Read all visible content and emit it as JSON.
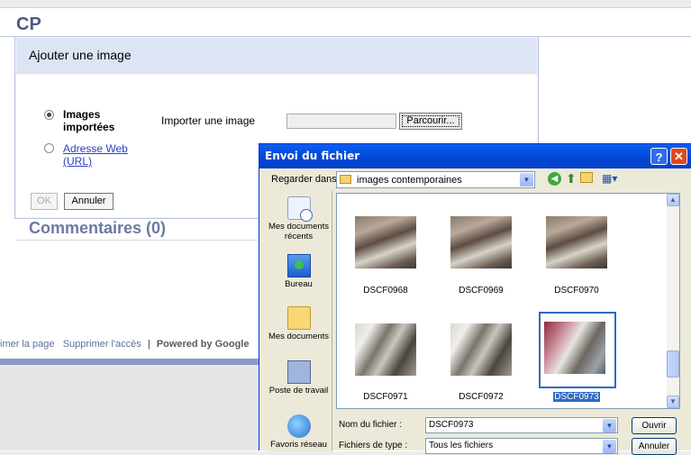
{
  "page": {
    "title": "CP",
    "comments_heading": "Commentaires (0)",
    "footer": {
      "link1": "imer la page",
      "link2": "Supprimer l'accès",
      "separator": "|",
      "powered": "Powered by Google"
    }
  },
  "add_image_dialog": {
    "title": "Ajouter une image",
    "options": {
      "imported": "Images importées",
      "web": "Adresse Web (URL)",
      "selected": "imported"
    },
    "import_label": "Importer une image",
    "file_value": "",
    "browse_label": "Parcourir...",
    "ok_label": "OK",
    "cancel_label": "Annuler"
  },
  "file_dialog": {
    "title": "Envoi du fichier",
    "help_label": "?",
    "close_label": "✕",
    "look_in_label": "Regarder dans :",
    "look_in_value": "images contemporaines",
    "places": [
      "Mes documents récents",
      "Bureau",
      "Mes documents",
      "Poste de travail",
      "Favoris réseau"
    ],
    "files": [
      "DSCF0968",
      "DSCF0969",
      "DSCF0970",
      "DSCF0971",
      "DSCF0972",
      "DSCF0973"
    ],
    "selected_file": "DSCF0973",
    "filename_label": "Nom du fichier :",
    "filename_value": "DSCF0973",
    "filetype_label": "Fichiers de type :",
    "filetype_value": "Tous les fichiers",
    "open_label": "Ouvrir",
    "cancel_label": "Annuler",
    "icons": [
      "back-icon",
      "up-folder-icon",
      "new-folder-icon",
      "view-menu-icon"
    ]
  }
}
